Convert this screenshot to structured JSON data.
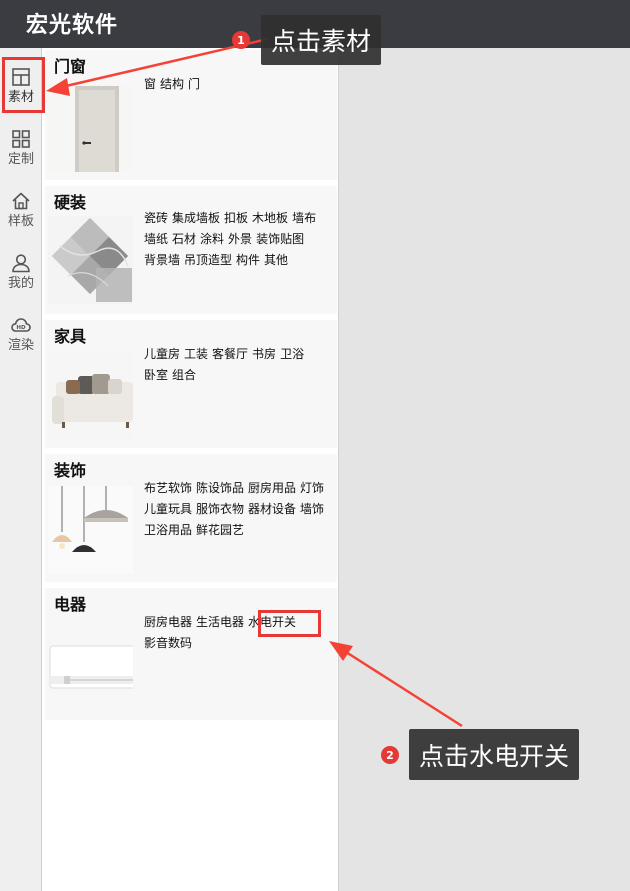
{
  "app": {
    "title": "宏光软件"
  },
  "sidebar": {
    "items": [
      {
        "label": "素材",
        "icon": "layout-icon"
      },
      {
        "label": "定制",
        "icon": "grid-icon"
      },
      {
        "label": "样板",
        "icon": "home-icon"
      },
      {
        "label": "我的",
        "icon": "user-icon"
      },
      {
        "label": "渲染",
        "icon": "cloud-render-icon"
      }
    ]
  },
  "categories": [
    {
      "title": "门窗",
      "links": [
        "窗",
        "结构",
        "门"
      ]
    },
    {
      "title": "硬装",
      "links": [
        "瓷砖",
        "集成墙板",
        "扣板",
        "木地板",
        "墙布",
        "墙纸",
        "石材",
        "涂料",
        "外景",
        "装饰贴图",
        "背景墙",
        "吊顶造型",
        "构件",
        "其他"
      ]
    },
    {
      "title": "家具",
      "links": [
        "儿童房",
        "工装",
        "客餐厅",
        "书房",
        "卫浴",
        "卧室",
        "组合"
      ]
    },
    {
      "title": "装饰",
      "links": [
        "布艺软饰",
        "陈设饰品",
        "厨房用品",
        "灯饰",
        "儿童玩具",
        "服饰衣物",
        "器材设备",
        "墙饰",
        "卫浴用品",
        "鲜花园艺"
      ]
    },
    {
      "title": "电器",
      "links": [
        "厨房电器",
        "生活电器",
        "水电开关",
        "影音数码"
      ]
    }
  ],
  "annotations": {
    "step1": {
      "number": "1",
      "text": "点击素材"
    },
    "step2": {
      "number": "2",
      "text": "点击水电开关"
    }
  },
  "colors": {
    "titlebar": "#3a3c42",
    "highlight": "#e53935",
    "callout_bg": "#303030"
  }
}
